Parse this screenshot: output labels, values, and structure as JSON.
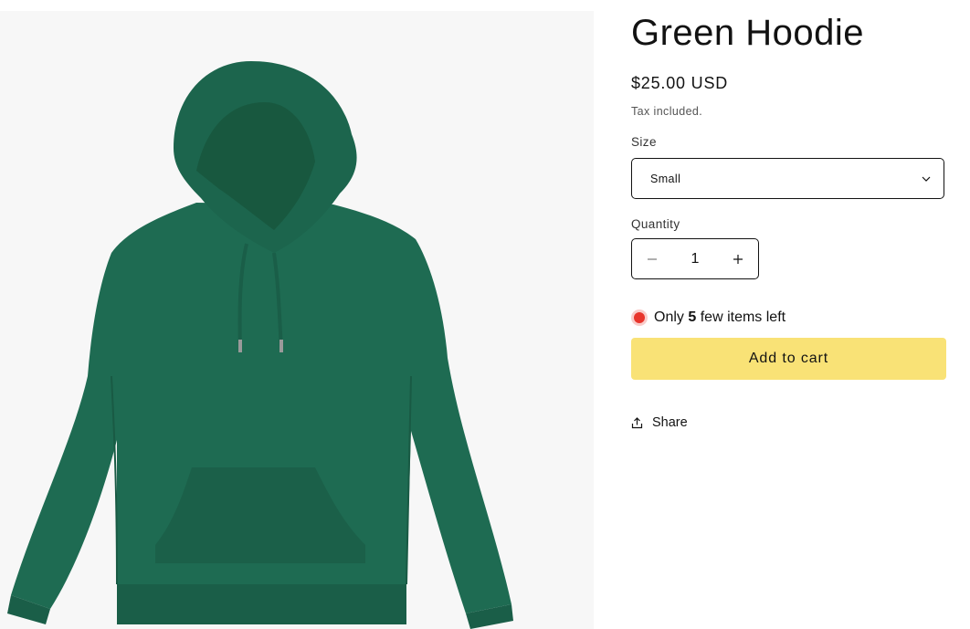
{
  "product": {
    "image_alt": "Green hoodie",
    "title": "Green Hoodie",
    "price": "$25.00 USD",
    "tax_note": "Tax included.",
    "size": {
      "label": "Size",
      "selected": "Small"
    },
    "quantity": {
      "label": "Quantity",
      "value": "1"
    },
    "stock": {
      "prefix": "Only",
      "count": "5",
      "suffix": "few items left",
      "indicator_color": "#e8352c"
    },
    "add_to_cart_label": "Add to cart",
    "share_label": "Share"
  },
  "colors": {
    "hoodie": "#1e6b52",
    "button": "#f9e276",
    "border": "#121212"
  },
  "icons": [
    "chevron-down-icon",
    "minus-icon",
    "plus-icon",
    "share-icon"
  ]
}
